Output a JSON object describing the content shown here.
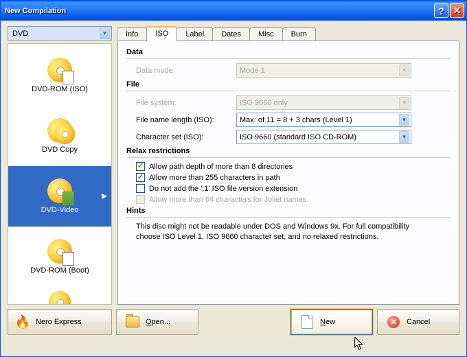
{
  "window": {
    "title": "New Compilation"
  },
  "disc_type": {
    "value": "DVD"
  },
  "sidebar": {
    "items": [
      {
        "label": "DVD-ROM (ISO)",
        "icon": "dvd-icon",
        "overlay": "page"
      },
      {
        "label": "DVD Copy",
        "icon": "dvd-icon",
        "overlay": "none"
      },
      {
        "label": "DVD-Video",
        "icon": "dvd-icon",
        "overlay": "film",
        "selected": true
      },
      {
        "label": "DVD-ROM (Boot)",
        "icon": "dvd-icon",
        "overlay": "boot"
      }
    ]
  },
  "tabs": {
    "items": [
      "Info",
      "ISO",
      "Label",
      "Dates",
      "Misc",
      "Burn"
    ],
    "active": "ISO"
  },
  "panel": {
    "data_section": "Data",
    "data_mode_label": "Data mode:",
    "data_mode_value": "Mode 1",
    "file_section": "File",
    "file_system_label": "File system:",
    "file_system_value": "ISO 9660 only",
    "file_name_length_label": "File name length (ISO):",
    "file_name_length_value": "Max. of 11 = 8 + 3 chars (Level 1)",
    "char_set_label": "Character set (ISO):",
    "char_set_value": "ISO 9660 (standard ISO CD-ROM)",
    "relax_section": "Relax restrictions",
    "chk_path_depth": "Allow path depth of more than 8 directories",
    "chk_255": "Allow more than 255 characters in path",
    "chk_no_ext": "Do not add the ';1' ISO file version extension",
    "chk_joliet": "Allow more than 64 characters for Joliet names",
    "hints_section": "Hints",
    "hints_text": "This disc might not be readable under DOS and Windows 9x. For full compatibility choose ISO Level 1, ISO 9660 character set, and no relaxed restrictions."
  },
  "buttons": {
    "nero_express": "Nero Express",
    "open": "Open...",
    "new": "New",
    "cancel": "Cancel"
  }
}
